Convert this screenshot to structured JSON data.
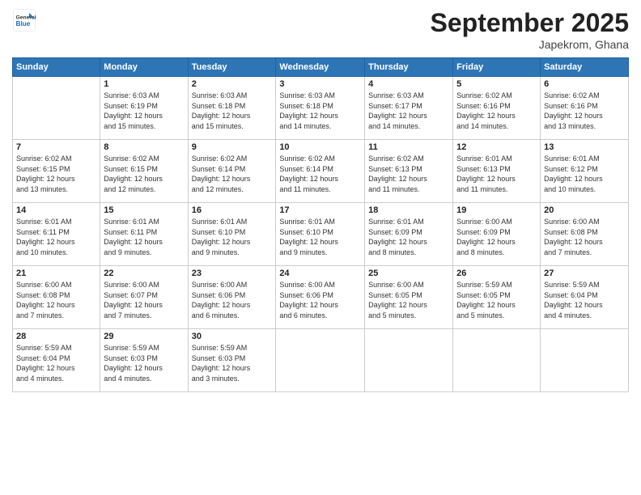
{
  "header": {
    "logo": {
      "line1": "General",
      "line2": "Blue"
    },
    "title": "September 2025",
    "subtitle": "Japekrom, Ghana"
  },
  "days_of_week": [
    "Sunday",
    "Monday",
    "Tuesday",
    "Wednesday",
    "Thursday",
    "Friday",
    "Saturday"
  ],
  "weeks": [
    [
      {
        "day": "",
        "info": ""
      },
      {
        "day": "1",
        "info": "Sunrise: 6:03 AM\nSunset: 6:19 PM\nDaylight: 12 hours\nand 15 minutes."
      },
      {
        "day": "2",
        "info": "Sunrise: 6:03 AM\nSunset: 6:18 PM\nDaylight: 12 hours\nand 15 minutes."
      },
      {
        "day": "3",
        "info": "Sunrise: 6:03 AM\nSunset: 6:18 PM\nDaylight: 12 hours\nand 14 minutes."
      },
      {
        "day": "4",
        "info": "Sunrise: 6:03 AM\nSunset: 6:17 PM\nDaylight: 12 hours\nand 14 minutes."
      },
      {
        "day": "5",
        "info": "Sunrise: 6:02 AM\nSunset: 6:16 PM\nDaylight: 12 hours\nand 14 minutes."
      },
      {
        "day": "6",
        "info": "Sunrise: 6:02 AM\nSunset: 6:16 PM\nDaylight: 12 hours\nand 13 minutes."
      }
    ],
    [
      {
        "day": "7",
        "info": "Sunrise: 6:02 AM\nSunset: 6:15 PM\nDaylight: 12 hours\nand 13 minutes."
      },
      {
        "day": "8",
        "info": "Sunrise: 6:02 AM\nSunset: 6:15 PM\nDaylight: 12 hours\nand 12 minutes."
      },
      {
        "day": "9",
        "info": "Sunrise: 6:02 AM\nSunset: 6:14 PM\nDaylight: 12 hours\nand 12 minutes."
      },
      {
        "day": "10",
        "info": "Sunrise: 6:02 AM\nSunset: 6:14 PM\nDaylight: 12 hours\nand 11 minutes."
      },
      {
        "day": "11",
        "info": "Sunrise: 6:02 AM\nSunset: 6:13 PM\nDaylight: 12 hours\nand 11 minutes."
      },
      {
        "day": "12",
        "info": "Sunrise: 6:01 AM\nSunset: 6:13 PM\nDaylight: 12 hours\nand 11 minutes."
      },
      {
        "day": "13",
        "info": "Sunrise: 6:01 AM\nSunset: 6:12 PM\nDaylight: 12 hours\nand 10 minutes."
      }
    ],
    [
      {
        "day": "14",
        "info": "Sunrise: 6:01 AM\nSunset: 6:11 PM\nDaylight: 12 hours\nand 10 minutes."
      },
      {
        "day": "15",
        "info": "Sunrise: 6:01 AM\nSunset: 6:11 PM\nDaylight: 12 hours\nand 9 minutes."
      },
      {
        "day": "16",
        "info": "Sunrise: 6:01 AM\nSunset: 6:10 PM\nDaylight: 12 hours\nand 9 minutes."
      },
      {
        "day": "17",
        "info": "Sunrise: 6:01 AM\nSunset: 6:10 PM\nDaylight: 12 hours\nand 9 minutes."
      },
      {
        "day": "18",
        "info": "Sunrise: 6:01 AM\nSunset: 6:09 PM\nDaylight: 12 hours\nand 8 minutes."
      },
      {
        "day": "19",
        "info": "Sunrise: 6:00 AM\nSunset: 6:09 PM\nDaylight: 12 hours\nand 8 minutes."
      },
      {
        "day": "20",
        "info": "Sunrise: 6:00 AM\nSunset: 6:08 PM\nDaylight: 12 hours\nand 7 minutes."
      }
    ],
    [
      {
        "day": "21",
        "info": "Sunrise: 6:00 AM\nSunset: 6:08 PM\nDaylight: 12 hours\nand 7 minutes."
      },
      {
        "day": "22",
        "info": "Sunrise: 6:00 AM\nSunset: 6:07 PM\nDaylight: 12 hours\nand 7 minutes."
      },
      {
        "day": "23",
        "info": "Sunrise: 6:00 AM\nSunset: 6:06 PM\nDaylight: 12 hours\nand 6 minutes."
      },
      {
        "day": "24",
        "info": "Sunrise: 6:00 AM\nSunset: 6:06 PM\nDaylight: 12 hours\nand 6 minutes."
      },
      {
        "day": "25",
        "info": "Sunrise: 6:00 AM\nSunset: 6:05 PM\nDaylight: 12 hours\nand 5 minutes."
      },
      {
        "day": "26",
        "info": "Sunrise: 5:59 AM\nSunset: 6:05 PM\nDaylight: 12 hours\nand 5 minutes."
      },
      {
        "day": "27",
        "info": "Sunrise: 5:59 AM\nSunset: 6:04 PM\nDaylight: 12 hours\nand 4 minutes."
      }
    ],
    [
      {
        "day": "28",
        "info": "Sunrise: 5:59 AM\nSunset: 6:04 PM\nDaylight: 12 hours\nand 4 minutes."
      },
      {
        "day": "29",
        "info": "Sunrise: 5:59 AM\nSunset: 6:03 PM\nDaylight: 12 hours\nand 4 minutes."
      },
      {
        "day": "30",
        "info": "Sunrise: 5:59 AM\nSunset: 6:03 PM\nDaylight: 12 hours\nand 3 minutes."
      },
      {
        "day": "",
        "info": ""
      },
      {
        "day": "",
        "info": ""
      },
      {
        "day": "",
        "info": ""
      },
      {
        "day": "",
        "info": ""
      }
    ]
  ]
}
